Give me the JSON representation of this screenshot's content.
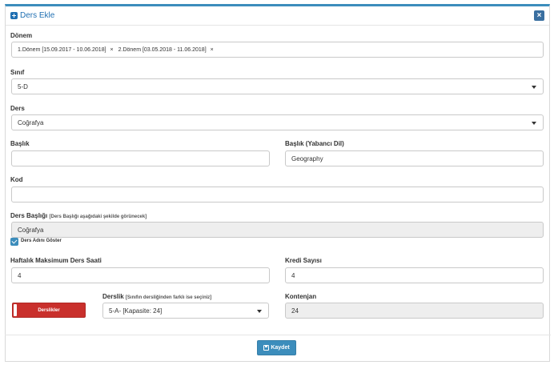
{
  "modal": {
    "title": "Ders Ekle",
    "close_label": "×"
  },
  "donem": {
    "label": "Dönem",
    "tags": [
      {
        "text": "1.Dönem [15.09.2017 - 10.06.2018]",
        "remove": "×"
      },
      {
        "text": "2.Dönem [03.05.2018 - 11.06.2018]",
        "remove": "×"
      }
    ]
  },
  "sinif": {
    "label": "Sınıf",
    "value": "5-D"
  },
  "ders": {
    "label": "Ders",
    "value": "Coğrafya"
  },
  "baslik": {
    "label": "Başlık",
    "value": ""
  },
  "baslik_yabanci": {
    "label": "Başlık (Yabancı Dil)",
    "value": "Geography"
  },
  "kod": {
    "label": "Kod",
    "value": ""
  },
  "ders_basligi": {
    "label": "Ders Başlığı",
    "hint": "[Ders Başlığı aşağıdaki şekilde görünecek]",
    "value": "Coğrafya"
  },
  "ders_adini_goster": {
    "label": "Ders Adını Göster",
    "checked": true
  },
  "haftalik": {
    "label": "Haftalık Maksimum Ders Saati",
    "value": "4"
  },
  "kredi": {
    "label": "Kredi Sayısı",
    "value": "4"
  },
  "derslikler_button": {
    "label": "Derslikler"
  },
  "derslik": {
    "label": "Derslik",
    "hint": "[Sınıfın dersliğinden farklı ise seçiniz]",
    "value": "5-A- [Kapasite: 24]"
  },
  "kontenjan": {
    "label": "Kontenjan",
    "value": "24"
  },
  "save_button": {
    "label": "Kaydet"
  },
  "colors": {
    "primary": "#3c8dbc",
    "title_blue": "#1f6fb2",
    "danger": "#c9302c",
    "disabled_bg": "#eeeeee"
  },
  "icons": [
    "plus-square-icon",
    "close-icon",
    "chevron-down-icon",
    "check-icon",
    "floppy-disk-icon"
  ]
}
